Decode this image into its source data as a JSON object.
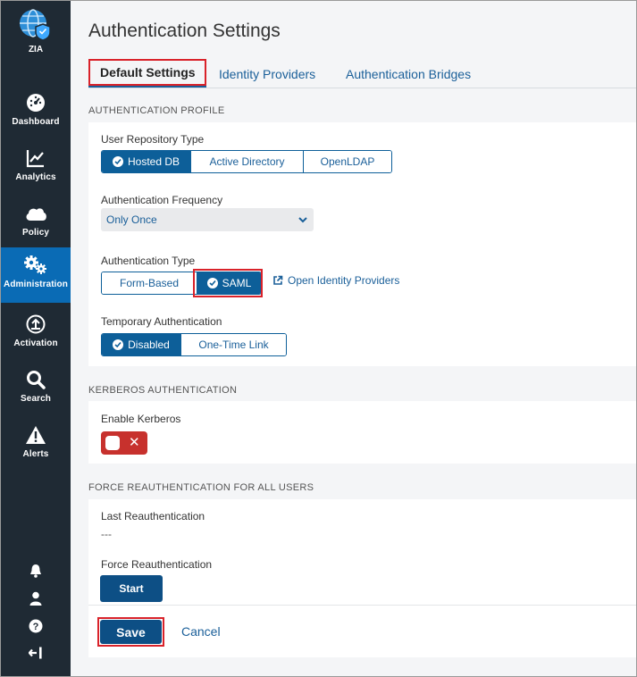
{
  "app": {
    "logo_label": "ZIA",
    "logo_icon": "globe-shield-icon"
  },
  "sidebar": {
    "items": [
      {
        "label": "Dashboard",
        "icon": "dashboard-gauge-icon",
        "active": false
      },
      {
        "label": "Analytics",
        "icon": "analytics-chart-icon",
        "active": false
      },
      {
        "label": "Policy",
        "icon": "cloud-icon",
        "active": false
      },
      {
        "label": "Administration",
        "icon": "gears-icon",
        "active": true
      },
      {
        "label": "Activation",
        "icon": "upload-circle-icon",
        "active": false
      },
      {
        "label": "Search",
        "icon": "search-icon",
        "active": false
      },
      {
        "label": "Alerts",
        "icon": "alert-triangle-icon",
        "active": false
      }
    ],
    "bottom_icons": [
      "bell-icon",
      "user-icon",
      "help-icon",
      "sign-out-icon"
    ]
  },
  "page": {
    "title": "Authentication Settings"
  },
  "tabs": [
    {
      "label": "Default Settings",
      "active": true
    },
    {
      "label": "Identity Providers",
      "active": false
    },
    {
      "label": "Authentication Bridges",
      "active": false
    }
  ],
  "auth_profile": {
    "section_title": "AUTHENTICATION PROFILE",
    "user_repository": {
      "label": "User Repository Type",
      "options": [
        "Hosted DB",
        "Active Directory",
        "OpenLDAP"
      ],
      "selected": "Hosted DB"
    },
    "auth_frequency": {
      "label": "Authentication Frequency",
      "value": "Only Once"
    },
    "auth_type": {
      "label": "Authentication Type",
      "options": [
        "Form-Based",
        "SAML"
      ],
      "selected": "SAML",
      "link_label": "Open Identity Providers"
    },
    "temp_auth": {
      "label": "Temporary Authentication",
      "options": [
        "Disabled",
        "One-Time Link"
      ],
      "selected": "Disabled"
    }
  },
  "kerberos": {
    "section_title": "KERBEROS AUTHENTICATION",
    "label": "Enable Kerberos",
    "enabled": false,
    "off_symbol": "✕"
  },
  "reauth": {
    "section_title": "FORCE REAUTHENTICATION FOR ALL USERS",
    "last_label": "Last Reauthentication",
    "last_value": "---",
    "force_label": "Force Reauthentication",
    "start_label": "Start"
  },
  "footer": {
    "save_label": "Save",
    "cancel_label": "Cancel"
  },
  "colors": {
    "sidebar_bg": "#1f2a34",
    "active_nav": "#0a6bb5",
    "primary": "#0d5f99",
    "highlight": "#d9222a",
    "toggle_off": "#c7312d"
  }
}
